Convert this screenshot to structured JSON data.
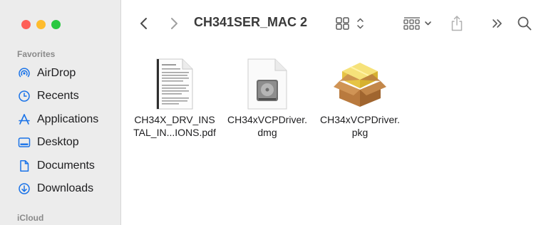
{
  "window": {
    "title": "CH341SER_MAC 2"
  },
  "sidebar": {
    "favorites_label": "Favorites",
    "icloud_label": "iCloud",
    "items": [
      {
        "label": "AirDrop",
        "icon": "airdrop-icon"
      },
      {
        "label": "Recents",
        "icon": "clock-icon"
      },
      {
        "label": "Applications",
        "icon": "applications-icon"
      },
      {
        "label": "Desktop",
        "icon": "desktop-icon"
      },
      {
        "label": "Documents",
        "icon": "document-icon"
      },
      {
        "label": "Downloads",
        "icon": "download-icon"
      }
    ]
  },
  "toolbar": {
    "back": "back-chevron-icon",
    "forward": "forward-chevron-icon",
    "view_mode": "grid-view-icon",
    "group": "group-by-icon",
    "share": "share-icon",
    "more": "more-chevrons-icon",
    "search": "search-icon"
  },
  "files": [
    {
      "line1": "CH34X_DRV_INS",
      "line2": "TAL_IN...IONS.pdf",
      "kind": "pdf"
    },
    {
      "line1": "CH34xVCPDriver.",
      "line2": "dmg",
      "kind": "dmg"
    },
    {
      "line1": "CH34xVCPDriver.",
      "line2": "pkg",
      "kind": "pkg"
    }
  ],
  "colors": {
    "accent": "#1a73e8",
    "sidebar_bg": "#ececec",
    "close": "#fe5f57",
    "minimize": "#febc2e",
    "zoom": "#28c840"
  }
}
